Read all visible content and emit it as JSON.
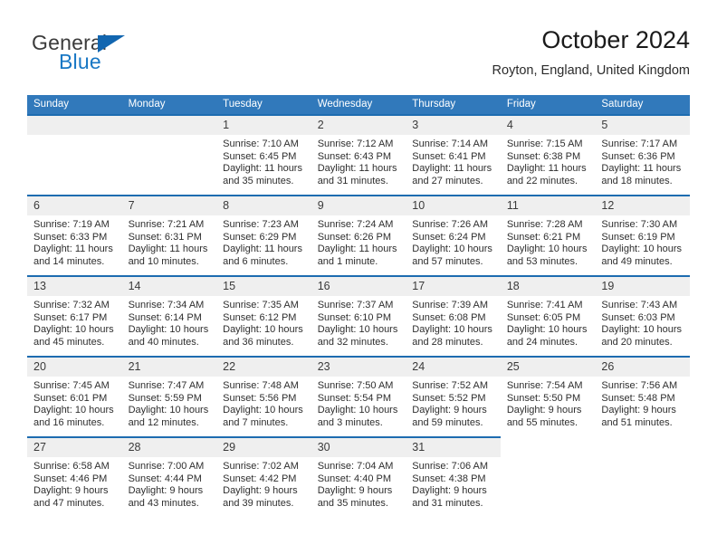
{
  "brand": {
    "name_top": "General",
    "name_bottom": "Blue",
    "triangle_color": "#1266b0",
    "blue_color": "#1877c4"
  },
  "header": {
    "title": "October 2024",
    "subtitle": "Royton, England, United Kingdom"
  },
  "theme": {
    "header_bg": "#3179bb",
    "row_line": "#1d6cb0",
    "daynum_bg": "#efefef",
    "text": "#2e2e2e"
  },
  "weekdays": [
    "Sunday",
    "Monday",
    "Tuesday",
    "Wednesday",
    "Thursday",
    "Friday",
    "Saturday"
  ],
  "labels": {
    "sunrise": "Sunrise:",
    "sunset": "Sunset:",
    "daylight": "Daylight:"
  },
  "weeks": [
    [
      {
        "day": "",
        "empty": true,
        "shaded": true
      },
      {
        "day": "",
        "empty": true,
        "shaded": true
      },
      {
        "day": "1",
        "sunrise": "Sunrise: 7:10 AM",
        "sunset": "Sunset: 6:45 PM",
        "daylight1": "Daylight: 11 hours",
        "daylight2": "and 35 minutes."
      },
      {
        "day": "2",
        "sunrise": "Sunrise: 7:12 AM",
        "sunset": "Sunset: 6:43 PM",
        "daylight1": "Daylight: 11 hours",
        "daylight2": "and 31 minutes."
      },
      {
        "day": "3",
        "sunrise": "Sunrise: 7:14 AM",
        "sunset": "Sunset: 6:41 PM",
        "daylight1": "Daylight: 11 hours",
        "daylight2": "and 27 minutes."
      },
      {
        "day": "4",
        "sunrise": "Sunrise: 7:15 AM",
        "sunset": "Sunset: 6:38 PM",
        "daylight1": "Daylight: 11 hours",
        "daylight2": "and 22 minutes."
      },
      {
        "day": "5",
        "sunrise": "Sunrise: 7:17 AM",
        "sunset": "Sunset: 6:36 PM",
        "daylight1": "Daylight: 11 hours",
        "daylight2": "and 18 minutes."
      }
    ],
    [
      {
        "day": "6",
        "sunrise": "Sunrise: 7:19 AM",
        "sunset": "Sunset: 6:33 PM",
        "daylight1": "Daylight: 11 hours",
        "daylight2": "and 14 minutes."
      },
      {
        "day": "7",
        "sunrise": "Sunrise: 7:21 AM",
        "sunset": "Sunset: 6:31 PM",
        "daylight1": "Daylight: 11 hours",
        "daylight2": "and 10 minutes."
      },
      {
        "day": "8",
        "sunrise": "Sunrise: 7:23 AM",
        "sunset": "Sunset: 6:29 PM",
        "daylight1": "Daylight: 11 hours",
        "daylight2": "and 6 minutes."
      },
      {
        "day": "9",
        "sunrise": "Sunrise: 7:24 AM",
        "sunset": "Sunset: 6:26 PM",
        "daylight1": "Daylight: 11 hours",
        "daylight2": "and 1 minute."
      },
      {
        "day": "10",
        "sunrise": "Sunrise: 7:26 AM",
        "sunset": "Sunset: 6:24 PM",
        "daylight1": "Daylight: 10 hours",
        "daylight2": "and 57 minutes."
      },
      {
        "day": "11",
        "sunrise": "Sunrise: 7:28 AM",
        "sunset": "Sunset: 6:21 PM",
        "daylight1": "Daylight: 10 hours",
        "daylight2": "and 53 minutes."
      },
      {
        "day": "12",
        "sunrise": "Sunrise: 7:30 AM",
        "sunset": "Sunset: 6:19 PM",
        "daylight1": "Daylight: 10 hours",
        "daylight2": "and 49 minutes."
      }
    ],
    [
      {
        "day": "13",
        "sunrise": "Sunrise: 7:32 AM",
        "sunset": "Sunset: 6:17 PM",
        "daylight1": "Daylight: 10 hours",
        "daylight2": "and 45 minutes."
      },
      {
        "day": "14",
        "sunrise": "Sunrise: 7:34 AM",
        "sunset": "Sunset: 6:14 PM",
        "daylight1": "Daylight: 10 hours",
        "daylight2": "and 40 minutes."
      },
      {
        "day": "15",
        "sunrise": "Sunrise: 7:35 AM",
        "sunset": "Sunset: 6:12 PM",
        "daylight1": "Daylight: 10 hours",
        "daylight2": "and 36 minutes."
      },
      {
        "day": "16",
        "sunrise": "Sunrise: 7:37 AM",
        "sunset": "Sunset: 6:10 PM",
        "daylight1": "Daylight: 10 hours",
        "daylight2": "and 32 minutes."
      },
      {
        "day": "17",
        "sunrise": "Sunrise: 7:39 AM",
        "sunset": "Sunset: 6:08 PM",
        "daylight1": "Daylight: 10 hours",
        "daylight2": "and 28 minutes."
      },
      {
        "day": "18",
        "sunrise": "Sunrise: 7:41 AM",
        "sunset": "Sunset: 6:05 PM",
        "daylight1": "Daylight: 10 hours",
        "daylight2": "and 24 minutes."
      },
      {
        "day": "19",
        "sunrise": "Sunrise: 7:43 AM",
        "sunset": "Sunset: 6:03 PM",
        "daylight1": "Daylight: 10 hours",
        "daylight2": "and 20 minutes."
      }
    ],
    [
      {
        "day": "20",
        "sunrise": "Sunrise: 7:45 AM",
        "sunset": "Sunset: 6:01 PM",
        "daylight1": "Daylight: 10 hours",
        "daylight2": "and 16 minutes."
      },
      {
        "day": "21",
        "sunrise": "Sunrise: 7:47 AM",
        "sunset": "Sunset: 5:59 PM",
        "daylight1": "Daylight: 10 hours",
        "daylight2": "and 12 minutes."
      },
      {
        "day": "22",
        "sunrise": "Sunrise: 7:48 AM",
        "sunset": "Sunset: 5:56 PM",
        "daylight1": "Daylight: 10 hours",
        "daylight2": "and 7 minutes."
      },
      {
        "day": "23",
        "sunrise": "Sunrise: 7:50 AM",
        "sunset": "Sunset: 5:54 PM",
        "daylight1": "Daylight: 10 hours",
        "daylight2": "and 3 minutes."
      },
      {
        "day": "24",
        "sunrise": "Sunrise: 7:52 AM",
        "sunset": "Sunset: 5:52 PM",
        "daylight1": "Daylight: 9 hours",
        "daylight2": "and 59 minutes."
      },
      {
        "day": "25",
        "sunrise": "Sunrise: 7:54 AM",
        "sunset": "Sunset: 5:50 PM",
        "daylight1": "Daylight: 9 hours",
        "daylight2": "and 55 minutes."
      },
      {
        "day": "26",
        "sunrise": "Sunrise: 7:56 AM",
        "sunset": "Sunset: 5:48 PM",
        "daylight1": "Daylight: 9 hours",
        "daylight2": "and 51 minutes."
      }
    ],
    [
      {
        "day": "27",
        "sunrise": "Sunrise: 6:58 AM",
        "sunset": "Sunset: 4:46 PM",
        "daylight1": "Daylight: 9 hours",
        "daylight2": "and 47 minutes."
      },
      {
        "day": "28",
        "sunrise": "Sunrise: 7:00 AM",
        "sunset": "Sunset: 4:44 PM",
        "daylight1": "Daylight: 9 hours",
        "daylight2": "and 43 minutes."
      },
      {
        "day": "29",
        "sunrise": "Sunrise: 7:02 AM",
        "sunset": "Sunset: 4:42 PM",
        "daylight1": "Daylight: 9 hours",
        "daylight2": "and 39 minutes."
      },
      {
        "day": "30",
        "sunrise": "Sunrise: 7:04 AM",
        "sunset": "Sunset: 4:40 PM",
        "daylight1": "Daylight: 9 hours",
        "daylight2": "and 35 minutes."
      },
      {
        "day": "31",
        "sunrise": "Sunrise: 7:06 AM",
        "sunset": "Sunset: 4:38 PM",
        "daylight1": "Daylight: 9 hours",
        "daylight2": "and 31 minutes."
      },
      {
        "day": "",
        "empty": true,
        "shaded": false
      },
      {
        "day": "",
        "empty": true,
        "shaded": false
      }
    ]
  ]
}
